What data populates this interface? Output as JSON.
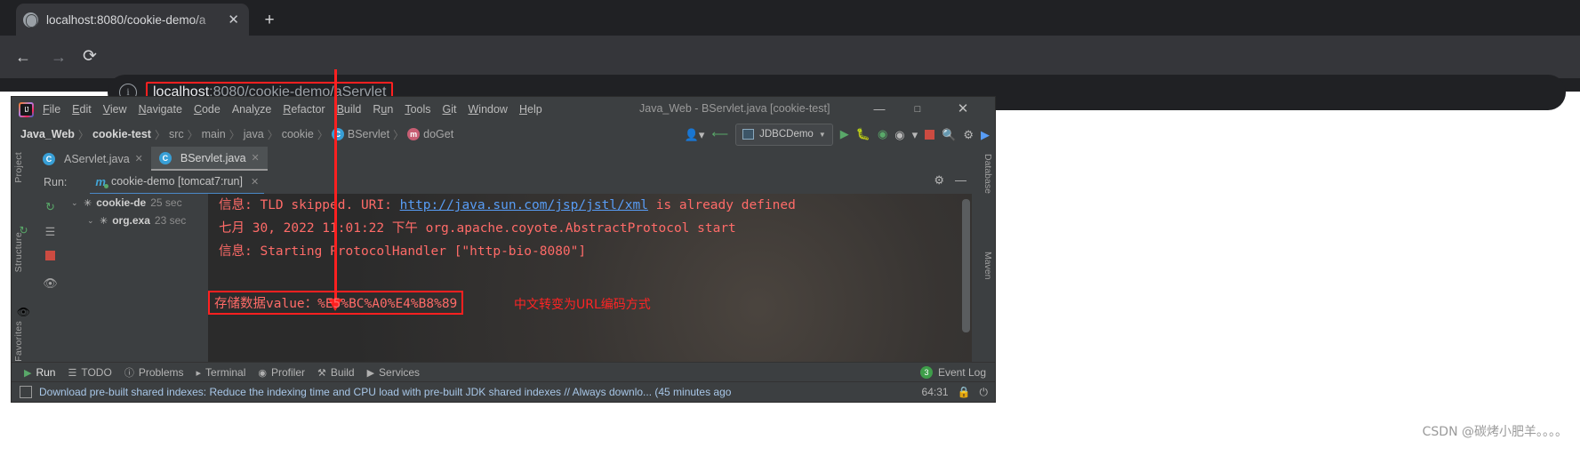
{
  "browser": {
    "tab": {
      "title": "localhost:8080/cookie-demo/a",
      "close_label": "✕",
      "favicon": "globe-icon"
    },
    "new_tab_label": "+",
    "back_label": "←",
    "forward_label": "→",
    "reload_label": "⟳",
    "info_label": "i",
    "url_host": "localhost",
    "url_rest": ":8080/cookie-demo/aServlet",
    "highlight_color": "#ff2020"
  },
  "ide": {
    "window_title": "Java_Web - BServlet.java [cookie-test]",
    "menu": [
      {
        "pre": "",
        "key": "F",
        "post": "ile"
      },
      {
        "pre": "",
        "key": "E",
        "post": "dit"
      },
      {
        "pre": "",
        "key": "V",
        "post": "iew"
      },
      {
        "pre": "",
        "key": "N",
        "post": "avigate"
      },
      {
        "pre": "",
        "key": "C",
        "post": "ode"
      },
      {
        "pre": "Anal",
        "key": "y",
        "post": "ze"
      },
      {
        "pre": "",
        "key": "R",
        "post": "efactor"
      },
      {
        "pre": "",
        "key": "B",
        "post": "uild"
      },
      {
        "pre": "R",
        "key": "u",
        "post": "n"
      },
      {
        "pre": "",
        "key": "T",
        "post": "ools"
      },
      {
        "pre": "",
        "key": "G",
        "post": "it"
      },
      {
        "pre": "",
        "key": "W",
        "post": "indow"
      },
      {
        "pre": "",
        "key": "H",
        "post": "elp"
      }
    ],
    "window_controls": {
      "minimize": "—",
      "maximize": "□",
      "close": "✕"
    },
    "breadcrumbs": [
      {
        "label": "Java_Web",
        "strong": true
      },
      {
        "label": "cookie-test",
        "strong": true
      },
      {
        "label": "src",
        "strong": false
      },
      {
        "label": "main",
        "strong": false
      },
      {
        "label": "java",
        "strong": false
      },
      {
        "label": "cookie",
        "strong": false
      },
      {
        "label": "BServlet",
        "strong": false,
        "badge": "C"
      },
      {
        "label": "doGet",
        "strong": false,
        "badge": "m"
      }
    ],
    "toolbar": {
      "run_config": "JDBCDemo",
      "user_icon": "user-icon",
      "updates_icon": "update-arrow-icon",
      "run_icon": "run-icon",
      "debug_icon": "debug-icon",
      "coverage_icon": "run-with-coverage-icon",
      "profile_icon": "profiler-icon",
      "dropdown_icon": "chevron-down-icon",
      "stop_icon": "stop-icon",
      "search_icon": "search-icon",
      "settings_icon": "gear-icon",
      "browser_icon": "open-in-browser-icon"
    },
    "editor_tabs": [
      {
        "label": "AServlet.java",
        "active": false
      },
      {
        "label": "BServlet.java",
        "active": true
      }
    ],
    "left_rail": [
      "Project",
      "Structure",
      "Favorites"
    ],
    "right_rail": [
      "Database",
      "Maven"
    ],
    "run_panel": {
      "label": "Run:",
      "tab_title": "cookie-demo [tomcat7:run]",
      "tree": [
        {
          "name": "cookie-de",
          "time": "25 sec",
          "indent": 0
        },
        {
          "name": "org.exa",
          "time": "23 sec",
          "indent": 1
        }
      ],
      "console_lines": [
        {
          "pre": "信息: TLD skipped. URI: ",
          "link": "http://java.sun.com/jsp/jstl/xml",
          "post": " is already defined"
        },
        {
          "pre": "七月 30, 2022 11:01:22 下午 org.apache.coyote.AbstractProtocol start",
          "link": "",
          "post": ""
        },
        {
          "pre": "信息: Starting ProtocolHandler [\"http-bio-8080\"]",
          "link": "",
          "post": ""
        }
      ],
      "highlighted_line": "存储数据value：%E5%BC%A0%E4%B8%89",
      "annotation": "中文转变为URL编码方式"
    },
    "bottom_tools": [
      {
        "label": "Run",
        "icon": "run-icon",
        "selected": true
      },
      {
        "label": "TODO",
        "icon": "todo-icon",
        "selected": false
      },
      {
        "label": "Problems",
        "icon": "problems-icon",
        "selected": false
      },
      {
        "label": "Terminal",
        "icon": "terminal-icon",
        "selected": false
      },
      {
        "label": "Profiler",
        "icon": "profiler-icon",
        "selected": false
      },
      {
        "label": "Build",
        "icon": "build-icon",
        "selected": false
      },
      {
        "label": "Services",
        "icon": "services-icon",
        "selected": false
      }
    ],
    "event_log": {
      "count": "3",
      "label": "Event Log"
    },
    "status_bar": {
      "message": "Download pre-built shared indexes: Reduce the indexing time and CPU load with pre-built JDK shared indexes // Always downlo... (45 minutes ago",
      "memory": "64:31",
      "lock_icon": "lock-icon",
      "power_icon": "power-save-icon"
    }
  },
  "watermark": "CSDN @碳烤小肥羊。。。。"
}
